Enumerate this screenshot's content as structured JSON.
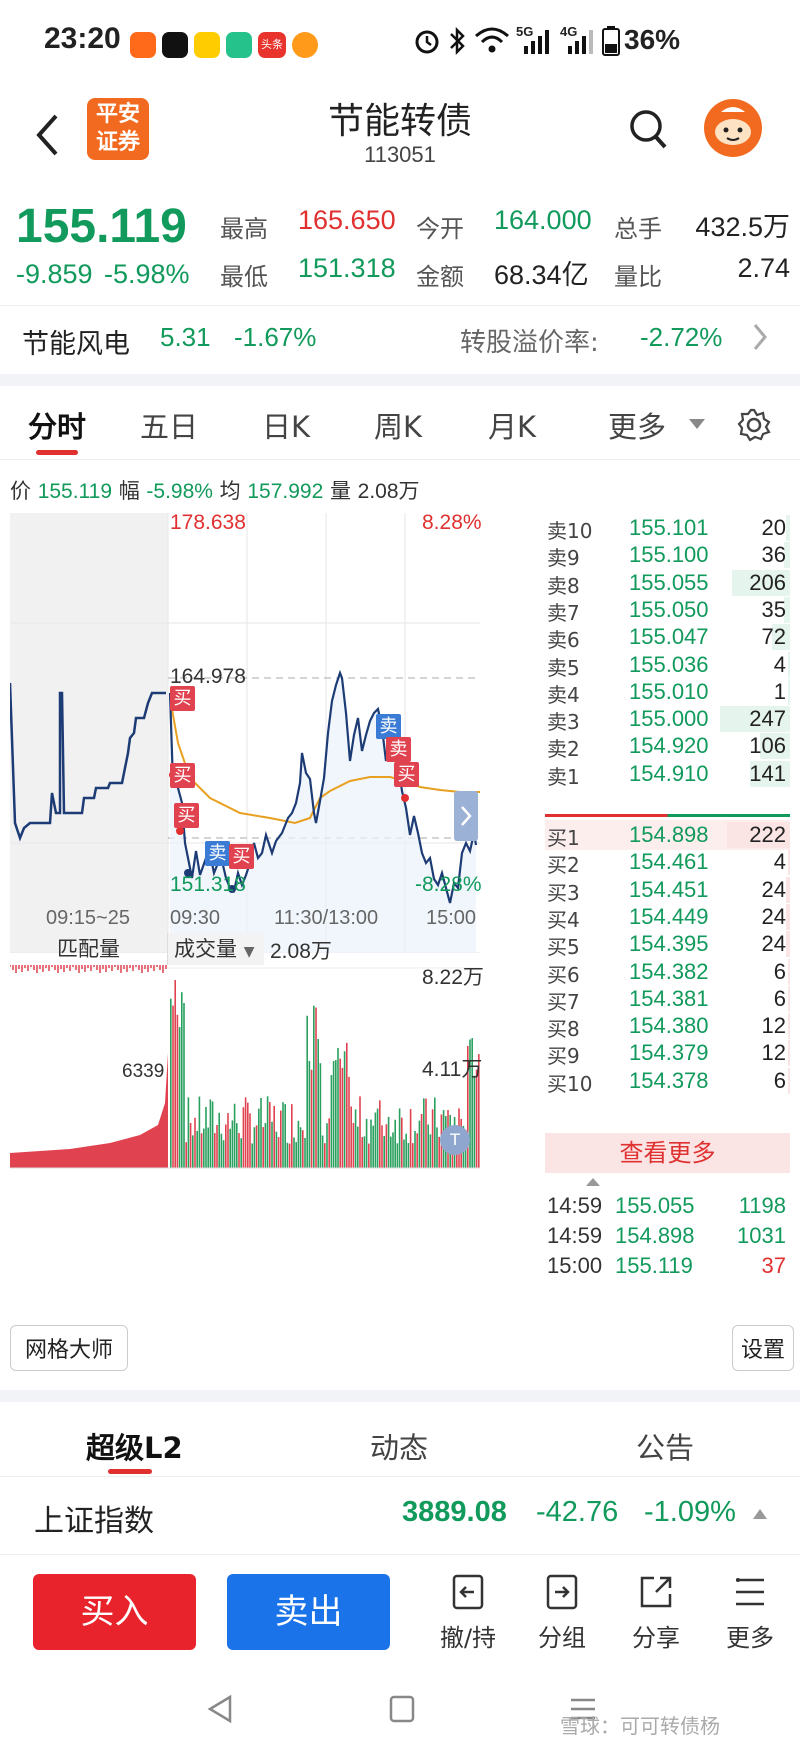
{
  "status_bar": {
    "time": "23:20",
    "battery": "36%",
    "net_5g": "5G",
    "net_4g": "4G",
    "app_icons": [
      "kuaishou-icon",
      "douyin-icon",
      "app-icon",
      "app-icon",
      "toutiao-icon",
      "video-icon"
    ],
    "toutiao_label": "头条"
  },
  "header": {
    "title": "节能转债",
    "code": "113051",
    "logo_line1": "平安",
    "logo_line2": "证券"
  },
  "quote": {
    "price": "155.119",
    "change": "-9.859",
    "change_pct": "-5.98%",
    "high_label": "最高",
    "high": "165.650",
    "low_label": "最低",
    "low": "151.318",
    "open_label": "今开",
    "open": "164.000",
    "amount_label": "金额",
    "amount": "68.34亿",
    "volume_label": "总手",
    "volume": "432.5万",
    "ratio_label": "量比",
    "ratio": "2.74"
  },
  "stock_row": {
    "name": "节能风电",
    "price": "5.31",
    "pct": "-1.67%",
    "premium_label": "转股溢价率:",
    "premium": "-2.72%"
  },
  "tabs": [
    {
      "label": "分时",
      "active": true
    },
    {
      "label": "五日"
    },
    {
      "label": "日K"
    },
    {
      "label": "周K"
    },
    {
      "label": "月K"
    },
    {
      "label": "更多"
    }
  ],
  "info_line": {
    "price_label": "价",
    "price": "155.119",
    "pct_label": "幅",
    "pct": "-5.98%",
    "avg_label": "均",
    "avg": "157.992",
    "vol_label": "量",
    "vol": "2.08万"
  },
  "chart": {
    "max_price": "178.638",
    "max_pct": "8.28%",
    "prev_close": "164.978",
    "min_price": "151.318",
    "min_pct": "-8.28%",
    "time_labels": [
      "09:15~25",
      "09:30",
      "11:30/13:00",
      "15:00"
    ],
    "match_label": "匹配量",
    "volume_label": "成交量",
    "volume_value": "2.08万",
    "vol_max": "8.22万",
    "vol_mid": "4.11万",
    "auction_value": "6339",
    "signals": [
      {
        "type": "买"
      },
      {
        "type": "买"
      },
      {
        "type": "买"
      },
      {
        "type": "卖"
      },
      {
        "type": "买"
      },
      {
        "type": "卖"
      },
      {
        "type": "卖"
      },
      {
        "type": "买"
      }
    ]
  },
  "order_book": {
    "asks": [
      {
        "label": "卖10",
        "price": "155.101",
        "vol": "20",
        "fill": 0.05
      },
      {
        "label": "卖9",
        "price": "155.100",
        "vol": "36",
        "fill": 0.08
      },
      {
        "label": "卖8",
        "price": "155.055",
        "vol": "206",
        "fill": 0.83
      },
      {
        "label": "卖7",
        "price": "155.050",
        "vol": "35",
        "fill": 0.08
      },
      {
        "label": "卖6",
        "price": "155.047",
        "vol": "72",
        "fill": 0.25
      },
      {
        "label": "卖5",
        "price": "155.036",
        "vol": "4",
        "fill": 0.02
      },
      {
        "label": "卖4",
        "price": "155.010",
        "vol": "1",
        "fill": 0.01
      },
      {
        "label": "卖3",
        "price": "155.000",
        "vol": "247",
        "fill": 1.0
      },
      {
        "label": "卖2",
        "price": "154.920",
        "vol": "106",
        "fill": 0.43
      },
      {
        "label": "卖1",
        "price": "154.910",
        "vol": "141",
        "fill": 0.57
      }
    ],
    "bids": [
      {
        "label": "买1",
        "price": "154.898",
        "vol": "222",
        "fill": 0.9
      },
      {
        "label": "买2",
        "price": "154.461",
        "vol": "4",
        "fill": 0.02
      },
      {
        "label": "买3",
        "price": "154.451",
        "vol": "24",
        "fill": 0.06
      },
      {
        "label": "买4",
        "price": "154.449",
        "vol": "24",
        "fill": 0.06
      },
      {
        "label": "买5",
        "price": "154.395",
        "vol": "24",
        "fill": 0.06
      },
      {
        "label": "买6",
        "price": "154.382",
        "vol": "6",
        "fill": 0.02
      },
      {
        "label": "买7",
        "price": "154.381",
        "vol": "6",
        "fill": 0.02
      },
      {
        "label": "买8",
        "price": "154.380",
        "vol": "12",
        "fill": 0.03
      },
      {
        "label": "买9",
        "price": "154.379",
        "vol": "12",
        "fill": 0.03
      },
      {
        "label": "买10",
        "price": "154.378",
        "vol": "6",
        "fill": 0.02
      }
    ],
    "more_label": "查看更多",
    "ticks": [
      {
        "time": "14:59",
        "price": "155.055",
        "vol": "1198",
        "side": "buy"
      },
      {
        "time": "14:59",
        "price": "154.898",
        "vol": "1031",
        "side": "buy"
      },
      {
        "time": "15:00",
        "price": "155.119",
        "vol": "37",
        "side": "sell"
      }
    ]
  },
  "tools": {
    "grid_master": "网格大师",
    "settings": "设置"
  },
  "sub_tabs": [
    {
      "label": "超级L2",
      "active": true
    },
    {
      "label": "动态"
    },
    {
      "label": "公告"
    }
  ],
  "index_row": {
    "name": "上证指数",
    "value": "3889.08",
    "change": "-42.76",
    "pct": "-1.09%"
  },
  "actions": {
    "buy": "买入",
    "sell": "卖出",
    "cancel": "撤/持",
    "group": "分组",
    "share": "分享",
    "more": "更多"
  },
  "watermark": "雪球：可可转债杨",
  "colors": {
    "up_red": "#e03030",
    "down_green": "#129a5c",
    "buy_button": "#e8232c",
    "sell_button": "#1a73e8",
    "avg_line": "#e8a020",
    "price_line": "#1d3b75"
  }
}
